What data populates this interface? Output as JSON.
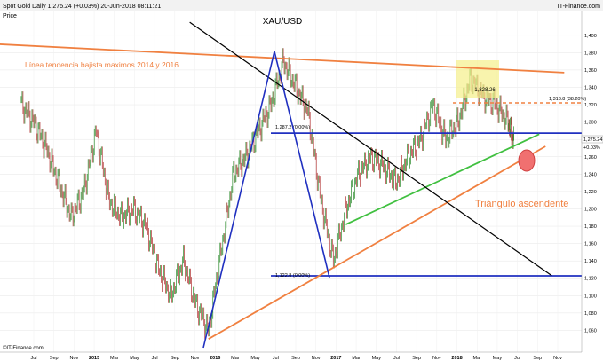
{
  "header": {
    "text": "Spot Gold   Daily   1,275.24 (+0.03%)   20-Jun-2018 08:11:21",
    "source": "IT-Finance.com",
    "price_label": "Price"
  },
  "footer": {
    "source": "©IT-Finance.com"
  },
  "chart_data": {
    "type": "line",
    "title": "XAU/USD",
    "instrument": "Spot Gold",
    "timeframe": "Daily",
    "last_price": "1,275.24",
    "change": "+0.03%",
    "datetime": "20-Jun-2018 08:11:21",
    "ylim": [
      1040,
      1410
    ],
    "y_ticks": [
      "1,400",
      "1,380",
      "1,360",
      "1,340",
      "1,320",
      "1,300",
      "1,280",
      "1,260",
      "1,240",
      "1,220",
      "1,200",
      "1,180",
      "1,160",
      "1,140",
      "1,120",
      "1,100",
      "1,080",
      "1,060"
    ],
    "x_ticks": [
      "Jul",
      "Sep",
      "Nov",
      "2015",
      "Mar",
      "May",
      "Jul",
      "Sep",
      "Nov",
      "2016",
      "Mar",
      "May",
      "Jul",
      "Sep",
      "Nov",
      "2017",
      "Mar",
      "May",
      "Jul",
      "Sep",
      "Nov",
      "2018",
      "Mar",
      "May",
      "Jul",
      "Sep",
      "Nov"
    ],
    "series": [
      {
        "type": "candlestick",
        "x": [
          2014.5,
          2014.6,
          2014.7,
          2014.8,
          2014.9,
          2015.0,
          2015.1,
          2015.2,
          2015.3,
          2015.4,
          2015.5,
          2015.6,
          2015.7,
          2015.8,
          2015.9,
          2016.0,
          2016.1,
          2016.2,
          2016.3,
          2016.4,
          2016.5,
          2016.6,
          2016.7,
          2016.8,
          2016.9,
          2017.0,
          2017.1,
          2017.2,
          2017.3,
          2017.4,
          2017.5,
          2017.6,
          2017.7,
          2017.8,
          2017.9,
          2018.0,
          2018.1,
          2018.2,
          2018.3,
          2018.4,
          2018.45
        ],
        "values": [
          1320,
          1300,
          1270,
          1230,
          1190,
          1220,
          1290,
          1210,
          1190,
          1200,
          1180,
          1130,
          1100,
          1140,
          1090,
          1060,
          1150,
          1240,
          1260,
          1290,
          1320,
          1370,
          1340,
          1310,
          1210,
          1140,
          1200,
          1240,
          1260,
          1250,
          1230,
          1260,
          1280,
          1320,
          1280,
          1300,
          1350,
          1330,
          1320,
          1300,
          1275
        ]
      }
    ],
    "annotations": {
      "long_trend_label": "Línea tendencia bajista maximos 2014 y 2016",
      "triangle_label": "Triángulo ascendente",
      "fib_level_1": "1,287.2 (0.00%)",
      "fib_level_2": "1,122.8 (0.00%)",
      "fib_level_3": "1,318.8 (38.20%)",
      "box_label": "1,328.26",
      "current_price_label": "1,275.24",
      "current_change_label": "+0.03%"
    },
    "lines": [
      {
        "name": "downtrend-2014-2016",
        "x": [
          2014.0,
          2018.85
        ],
        "y": [
          1392,
          1357
        ],
        "color": "#f08040"
      },
      {
        "name": "horizontal-1287",
        "x": [
          2016.5,
          2018.99
        ],
        "y": [
          1287.2,
          1287.2
        ],
        "color": "#2030c0"
      },
      {
        "name": "horizontal-1122",
        "x": [
          2016.5,
          2018.99
        ],
        "y": [
          1122.8,
          1122.8
        ],
        "color": "#2030c0"
      },
      {
        "name": "triangle-lower-green",
        "x": [
          2017.1,
          2018.65
        ],
        "y": [
          1182,
          1286
        ],
        "color": "#40c040"
      },
      {
        "name": "triangle-lower-orange",
        "x": [
          2016.0,
          2018.7
        ],
        "y": [
          1050,
          1272
        ],
        "color": "#f08040"
      },
      {
        "name": "black-downtrend",
        "x": [
          2015.85,
          2018.75
        ],
        "y": [
          1415,
          1123
        ],
        "color": "#000000"
      }
    ]
  }
}
